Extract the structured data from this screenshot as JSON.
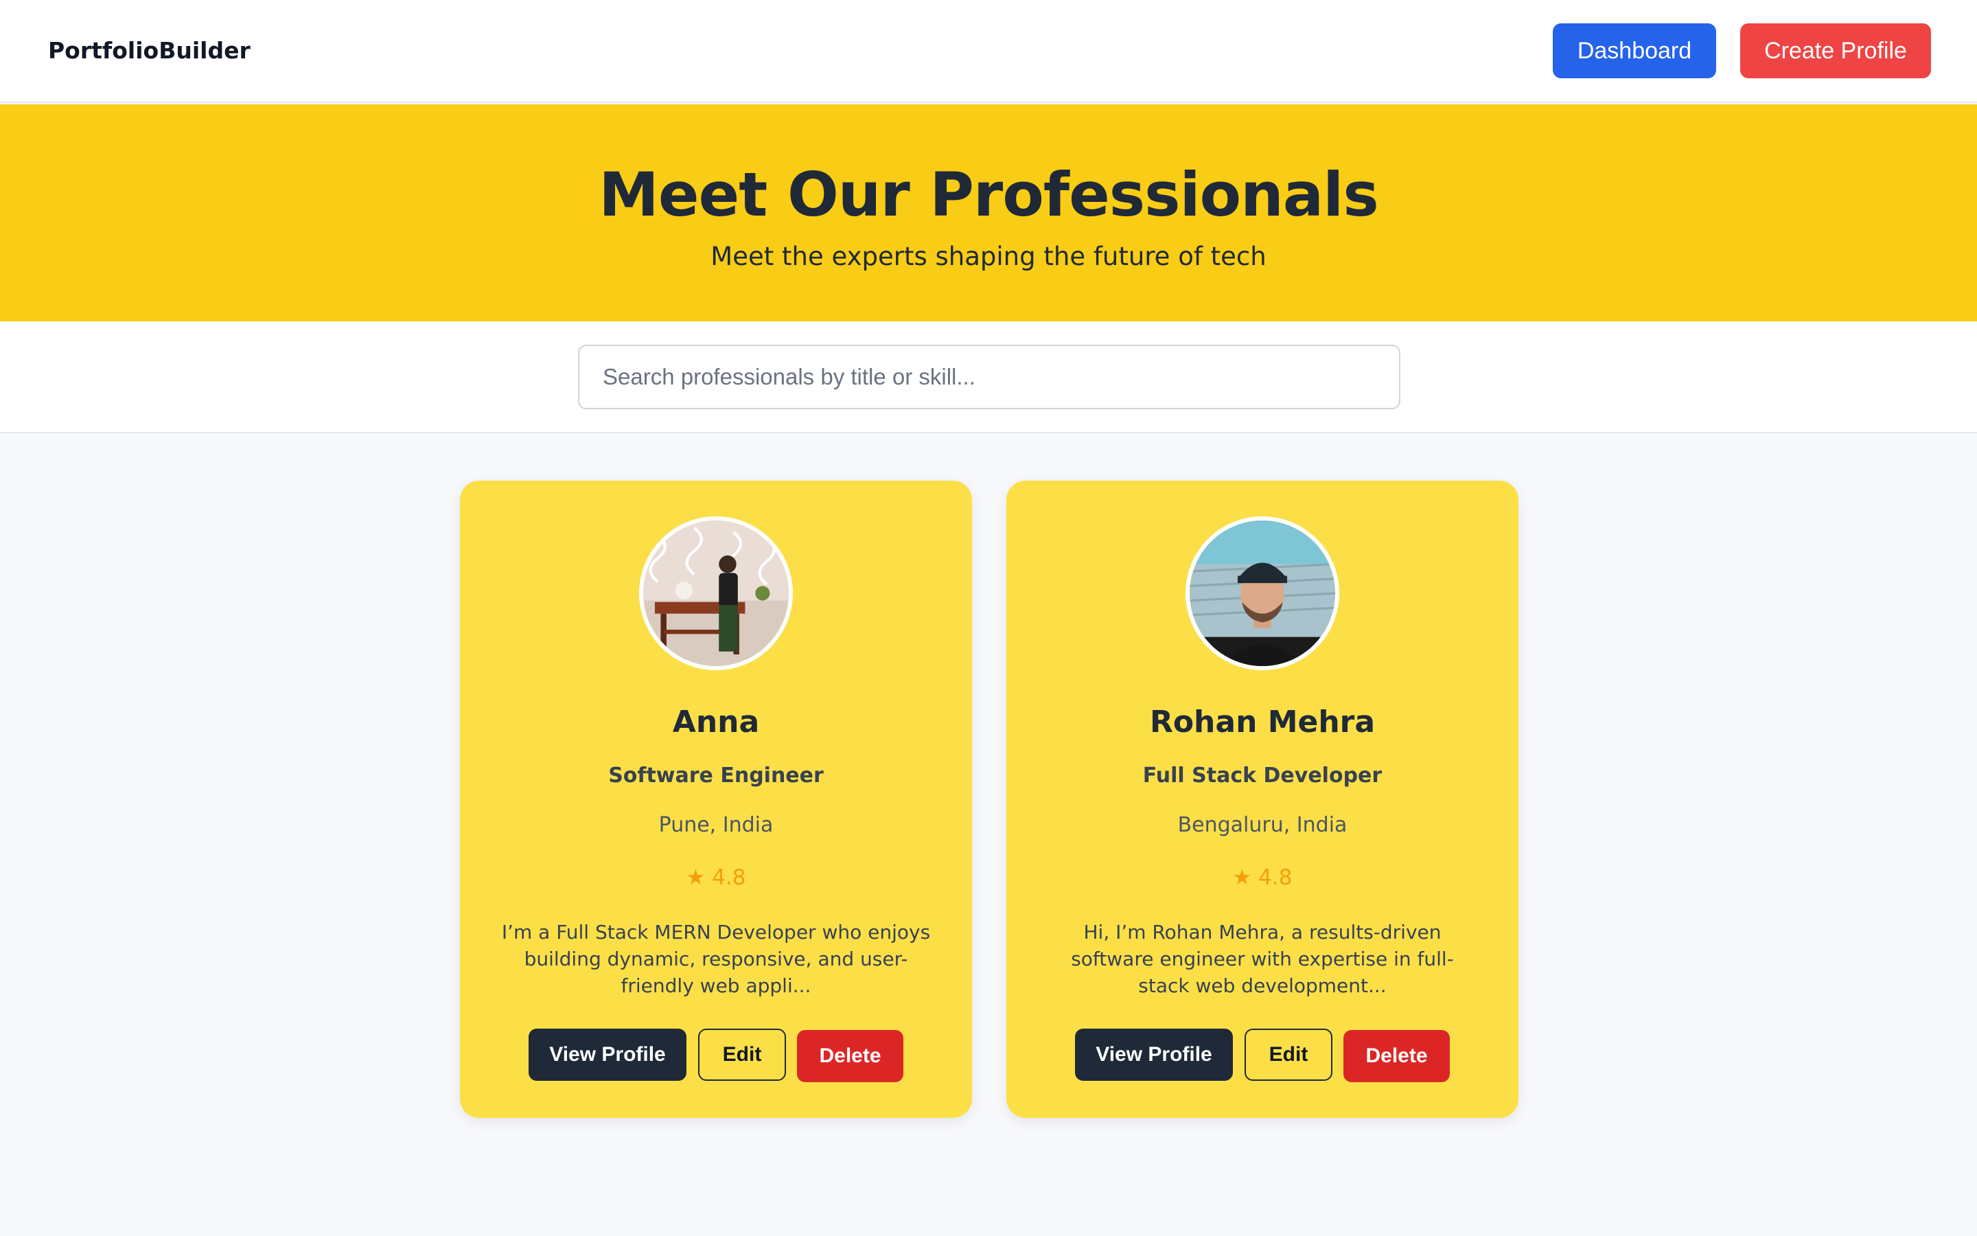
{
  "navbar": {
    "brand": "PortfolioBuilder",
    "dashboard_label": "Dashboard",
    "create_profile_label": "Create Profile"
  },
  "hero": {
    "title": "Meet Our Professionals",
    "subtitle": "Meet the experts shaping the future of tech"
  },
  "search": {
    "placeholder": "Search professionals by title or skill...",
    "value": ""
  },
  "profiles": [
    {
      "name": "Anna",
      "title": "Software Engineer",
      "location": "Pune, India",
      "rating": "★ 4.8",
      "bio": "I’m a Full Stack MERN Developer who enjoys building dynamic, responsive, and user-friendly web appli...",
      "view_label": "View Profile",
      "edit_label": "Edit",
      "delete_label": "Delete"
    },
    {
      "name": "Rohan Mehra",
      "title": "Full Stack Developer",
      "location": "Bengaluru, India",
      "rating": "★ 4.8",
      "bio": "Hi, I’m Rohan Mehra, a results-driven software engineer with expertise in full-stack web development...",
      "view_label": "View Profile",
      "edit_label": "Edit",
      "delete_label": "Delete"
    }
  ],
  "colors": {
    "hero_bg": "#f9cc15",
    "card_bg": "#fcdf47",
    "dashboard_btn": "#2563eb",
    "create_btn": "#ef4444",
    "delete_btn": "#dc2626",
    "view_btn": "#1f2937",
    "rating": "#f59e0b"
  }
}
